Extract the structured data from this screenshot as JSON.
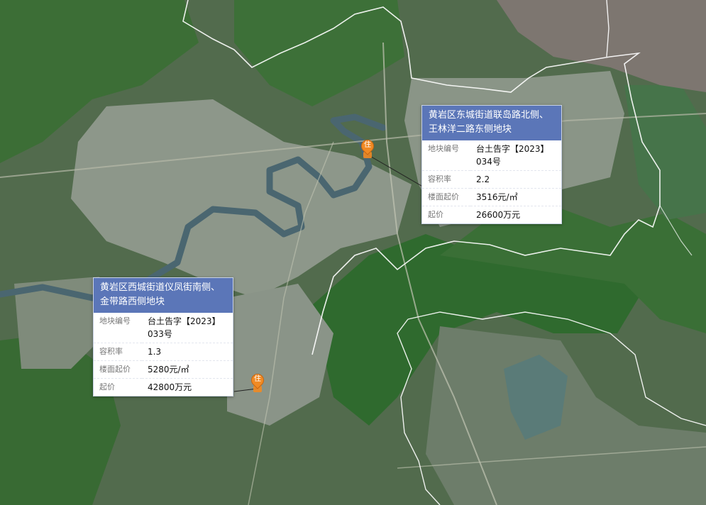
{
  "map": {
    "colors": {
      "forest": "#3f6a3c",
      "urban": "#8f9a8c",
      "river": "#4e6a74",
      "boundary": "#ffffff",
      "pin": "#f08a24",
      "header": "#5b76b8"
    }
  },
  "parcels": [
    {
      "title": "黄岩区东城街道联岛路北侧、王林洋二路东侧地块",
      "pin_label": "住",
      "rows": [
        {
          "key": "地块编号",
          "value": "台土告字【2023】034号"
        },
        {
          "key": "容积率",
          "value": "2.2"
        },
        {
          "key": "楼面起价",
          "value": "3516元/㎡"
        },
        {
          "key": "起价",
          "value": "26600万元"
        }
      ]
    },
    {
      "title": "黄岩区西城街道仪凤街南侧、金带路西侧地块",
      "pin_label": "住",
      "rows": [
        {
          "key": "地块编号",
          "value": "台土告字【2023】033号"
        },
        {
          "key": "容积率",
          "value": "1.3"
        },
        {
          "key": "楼面起价",
          "value": "5280元/㎡"
        },
        {
          "key": "起价",
          "value": "42800万元"
        }
      ]
    }
  ]
}
